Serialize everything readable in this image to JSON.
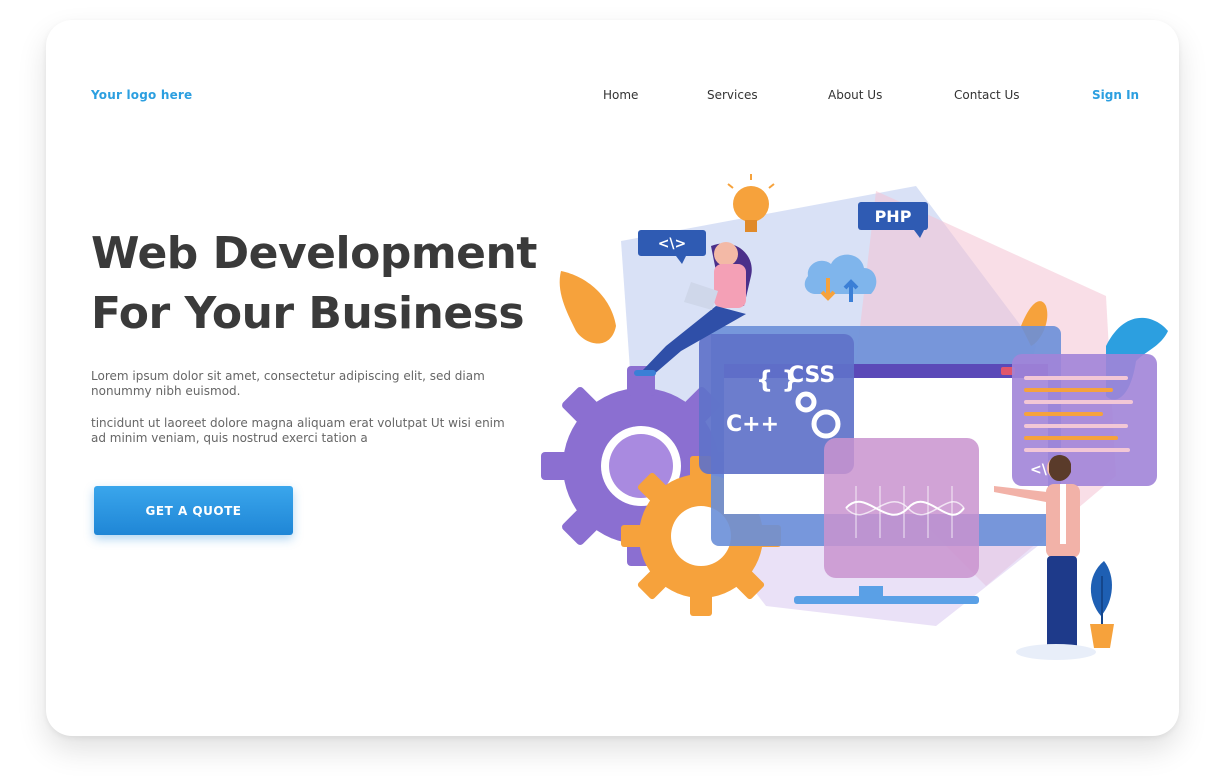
{
  "header": {
    "logo_text": "Your logo here",
    "nav": [
      "Home",
      "Services",
      "About Us",
      "Contact Us"
    ],
    "sign_in": "Sign In"
  },
  "hero": {
    "title_line1": "Web Development",
    "title_line2": "For Your Business",
    "paragraph1": "Lorem ipsum dolor sit amet, consectetur adipiscing elit, sed diam nonummy nibh euismod.",
    "paragraph2": "tincidunt ut laoreet dolore magna aliquam erat volutpat Ut wisi enim ad minim veniam, quis nostrud exerci tation a",
    "cta_label": "GET A QUOTE"
  },
  "illustration": {
    "tags": {
      "html": "<\\>",
      "php": "PHP",
      "css": "CSS",
      "braces": "{ }",
      "cpp": "C++",
      "code_small": "<\\>"
    },
    "colors": {
      "primary_blue": "#2c9fe0",
      "purple": "#8b6fd1",
      "orange": "#f6a23c",
      "pink": "#f4b5c8",
      "navy": "#1e3a8a"
    }
  }
}
